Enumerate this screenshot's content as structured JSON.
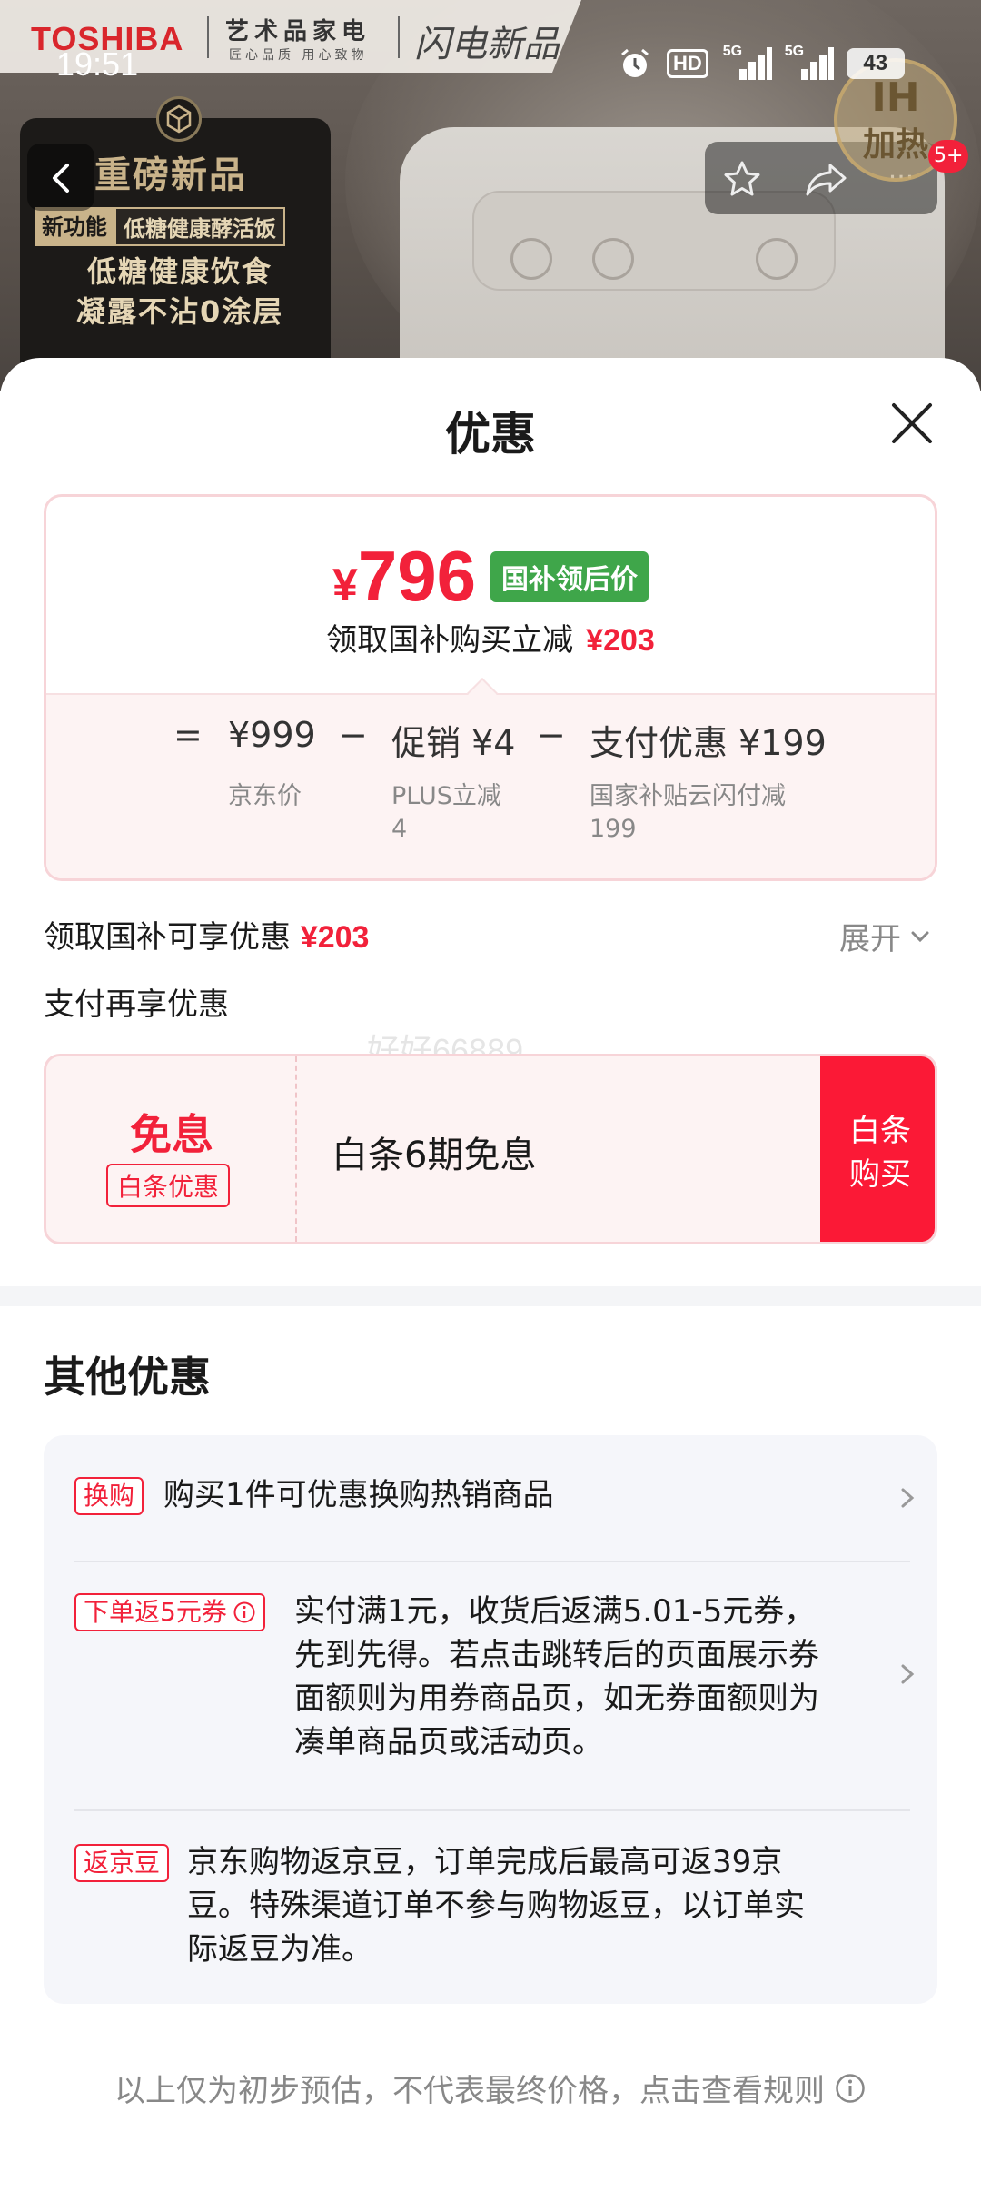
{
  "status_bar": {
    "time": "19:51",
    "hd_label": "HD",
    "signal1_label": "5G",
    "signal2_label": "5G",
    "battery": "43"
  },
  "banner": {
    "brand_logo": "TOSHIBA",
    "brand_line1": "艺术品家电",
    "brand_line2": "匠心品质 用心致物",
    "brand_slogan": "闪电新品",
    "promo_title": "重磅新品",
    "promo_tag1": "新功能",
    "promo_tag2": "低糖健康酵活饭",
    "promo_line1": "低糖健康饮食",
    "promo_line2": "凝露不沾0涂层",
    "ih_badge_line1": "IH",
    "ih_badge_line2": "加热",
    "message_count": "5+",
    "more_label": "···"
  },
  "sheet": {
    "title": "优惠"
  },
  "price_card": {
    "currency": "¥",
    "final_price": "796",
    "final_tag": "国补领后价",
    "subsidy_text": "领取国补购买立减",
    "subsidy_amount": "¥203",
    "equals": "=",
    "minus": "−",
    "jd_price": "¥999",
    "jd_price_label": "京东价",
    "promo_amount": "促销 ¥4",
    "promo_label_line1": "PLUS立减",
    "promo_label_line2": "4",
    "pay_amount": "支付优惠 ¥199",
    "pay_label_line1": "国家补贴云闪付减",
    "pay_label_line2": "199"
  },
  "subsidy_row": {
    "text": "领取国补可享优惠",
    "amount": "¥203",
    "expand_label": "展开"
  },
  "pay_row": {
    "text": "支付再享优惠"
  },
  "watermark": "好好66889",
  "coupon": {
    "big": "免息",
    "small": "白条优惠",
    "desc": "白条6期免息",
    "buy_line1": "白条",
    "buy_line2": "购买"
  },
  "other": {
    "title": "其他优惠",
    "items": [
      {
        "tag": "换购",
        "lines": [
          "购买1件可优惠换购热销商品"
        ],
        "chevron": true
      },
      {
        "tag": "下单返5元券",
        "lines": [
          "实付满1元，收货后返满5.01-5元券，",
          "先到先得。若点击跳转后的页面展示券",
          "面额则为用券商品页，如无券面额则为",
          "凑单商品页或活动页。"
        ],
        "chevron": true
      },
      {
        "tag": "返京豆",
        "lines": [
          "京东购物返京豆，订单完成后最高可返39京",
          "豆。特殊渠道订单不参与购物返豆，以订单实",
          "际返豆为准。"
        ],
        "chevron": false
      }
    ]
  },
  "footnote": "以上仅为初步预估，不代表最终价格，点击查看规则",
  "colors": {
    "accent_red": "#f2213a",
    "buy_button": "#fb1936",
    "tag_green": "#3fa64a"
  }
}
